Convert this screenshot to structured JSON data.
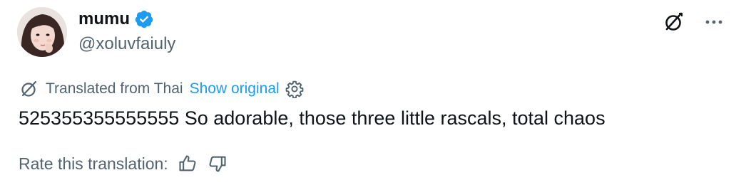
{
  "author": {
    "display_name": "mumu",
    "handle": "@xoluvfaiuly",
    "verified_color": "#1d9bf0"
  },
  "icons": {
    "verified": "verified-badge-icon",
    "grok": "grok-icon",
    "more": "more-icon",
    "translate": "translate-globe-icon",
    "settings": "gear-icon",
    "thumbs_up": "thumbs-up-icon",
    "thumbs_down": "thumbs-down-icon"
  },
  "translation": {
    "label": "Translated from Thai",
    "show_original": "Show original",
    "link_color": "#1d9bf0"
  },
  "tweet": {
    "text": "525355355555555 So adorable, those three little rascals, total chaos"
  },
  "rating": {
    "label": "Rate this translation:"
  }
}
